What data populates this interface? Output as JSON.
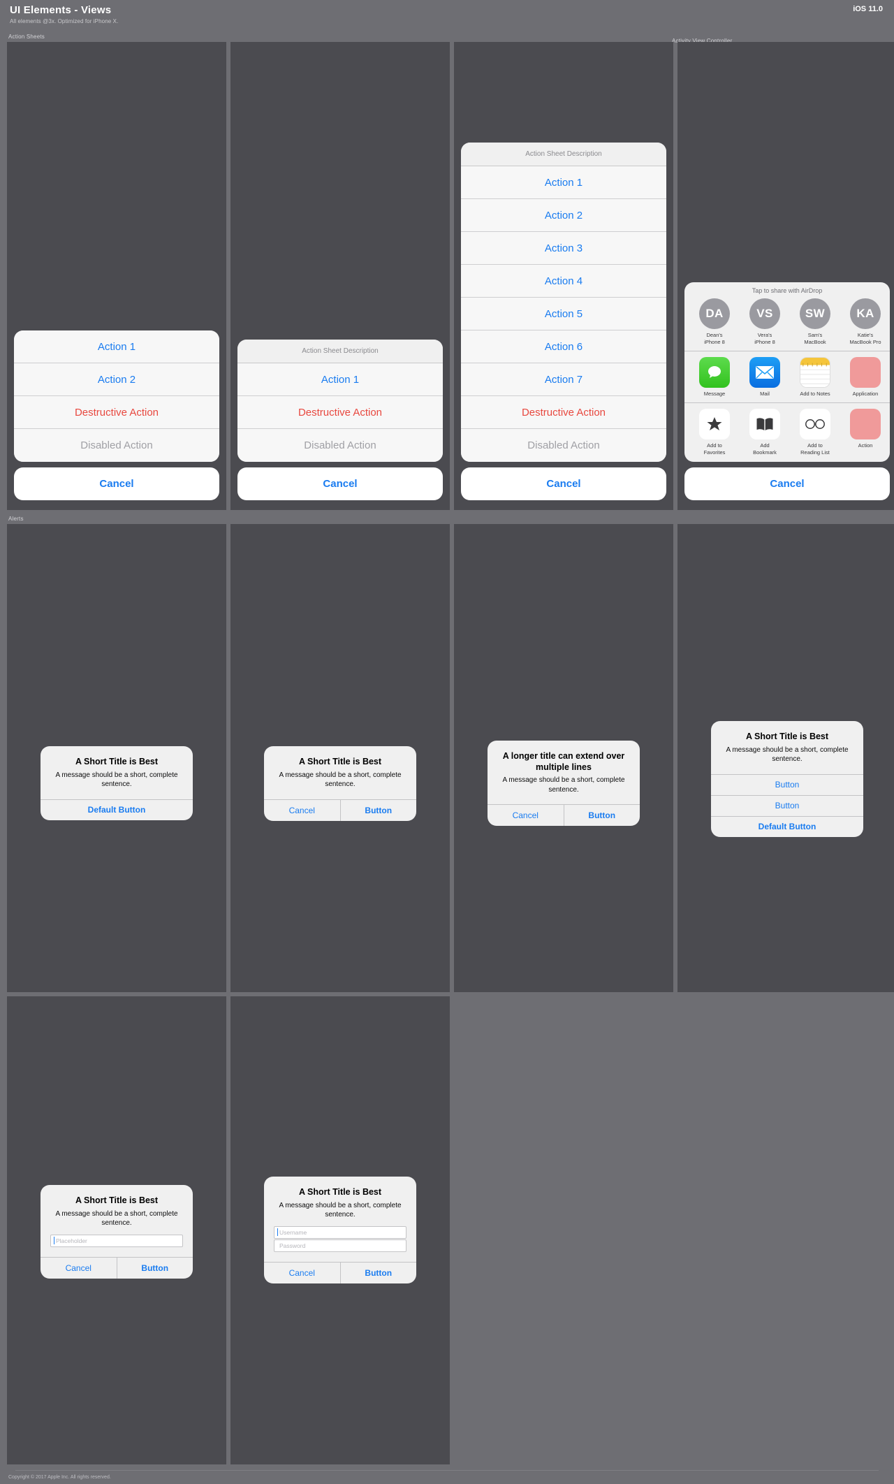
{
  "header": {
    "title": "UI Elements - Views",
    "subtitle": "All elements @3x. Optimized for iPhone X.",
    "os_version": "iOS 11.0"
  },
  "sections": {
    "action_sheets": "Action Sheets",
    "activity_view": "Activity View Controller",
    "alerts": "Alerts"
  },
  "colors": {
    "tint_blue": "#1a7cf0",
    "destructive_red": "#e8483f",
    "disabled_gray": "#a0a0a5",
    "panel_bg": "#4b4b50",
    "page_bg": "#6e6e73"
  },
  "action_sheets": [
    {
      "description": null,
      "actions": [
        "Action 1",
        "Action 2"
      ],
      "destructive": "Destructive Action",
      "disabled": "Disabled Action",
      "cancel": "Cancel"
    },
    {
      "description": "Action Sheet Description",
      "actions": [
        "Action 1"
      ],
      "destructive": "Destructive Action",
      "disabled": "Disabled Action",
      "cancel": "Cancel"
    },
    {
      "description": "Action Sheet Description",
      "actions": [
        "Action 1",
        "Action 2",
        "Action 3",
        "Action 4",
        "Action 5",
        "Action 6",
        "Action 7"
      ],
      "destructive": "Destructive Action",
      "disabled": "Disabled Action",
      "cancel": "Cancel"
    }
  ],
  "activity_sheet": {
    "airdrop_title": "Tap to share with AirDrop",
    "contacts": [
      {
        "initials": "DA",
        "name": "Dean's\niPhone 8"
      },
      {
        "initials": "VS",
        "name": "Vera's\niPhone 8"
      },
      {
        "initials": "SW",
        "name": "Sam's\nMacBook"
      },
      {
        "initials": "KA",
        "name": "Katie's\nMacBook Pro"
      }
    ],
    "apps": [
      {
        "label": "Message",
        "icon": "message-icon"
      },
      {
        "label": "Mail",
        "icon": "mail-icon"
      },
      {
        "label": "Add to Notes",
        "icon": "notes-icon"
      },
      {
        "label": "Application",
        "icon": "generic-app-icon"
      }
    ],
    "actions": [
      {
        "label": "Add to\nFavorites",
        "icon": "star-icon"
      },
      {
        "label": "Add\nBookmark",
        "icon": "book-icon"
      },
      {
        "label": "Add to\nReading List",
        "icon": "glasses-icon"
      },
      {
        "label": "Action",
        "icon": "generic-action-icon"
      }
    ],
    "cancel": "Cancel"
  },
  "alerts": [
    {
      "title": "A Short Title is Best",
      "message": "A message should be a short, complete sentence.",
      "layout": "single",
      "buttons": [
        {
          "label": "Default Button",
          "bold": true
        }
      ]
    },
    {
      "title": "A Short Title is Best",
      "message": "A message should be a short, complete sentence.",
      "layout": "horizontal",
      "buttons": [
        {
          "label": "Cancel",
          "bold": false
        },
        {
          "label": "Button",
          "bold": true
        }
      ]
    },
    {
      "title": "A longer title can extend over multiple lines",
      "message": "A message should be a short, complete sentence.",
      "layout": "horizontal",
      "buttons": [
        {
          "label": "Cancel",
          "bold": false
        },
        {
          "label": "Button",
          "bold": true
        }
      ]
    },
    {
      "title": "A Short Title is Best",
      "message": "A message should be a short, complete sentence.",
      "layout": "stacked",
      "buttons": [
        {
          "label": "Button",
          "bold": false
        },
        {
          "label": "Button",
          "bold": false
        },
        {
          "label": "Default Button",
          "bold": true
        }
      ]
    },
    {
      "title": "A Short Title is Best",
      "message": "A message should be a short, complete sentence.",
      "layout": "one-field",
      "fields": [
        {
          "placeholder": "Placeholder",
          "value": ""
        }
      ],
      "buttons": [
        {
          "label": "Cancel",
          "bold": false
        },
        {
          "label": "Button",
          "bold": true
        }
      ]
    },
    {
      "title": "A Short Title is Best",
      "message": "A message should be a short, complete sentence.",
      "layout": "two-fields",
      "fields": [
        {
          "placeholder": "Username",
          "value": ""
        },
        {
          "placeholder": "Password",
          "value": ""
        }
      ],
      "buttons": [
        {
          "label": "Cancel",
          "bold": false
        },
        {
          "label": "Button",
          "bold": true
        }
      ]
    }
  ],
  "footer": {
    "copyright": "Copyright © 2017 Apple Inc. All rights reserved."
  }
}
